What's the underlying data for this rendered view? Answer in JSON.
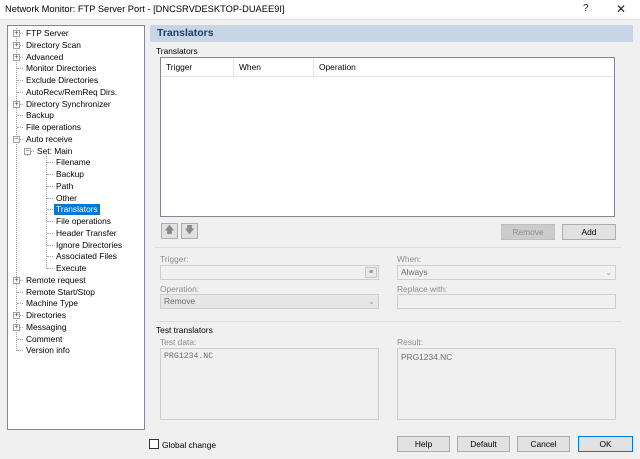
{
  "window": {
    "title": "Network Monitor: FTP Server Port - [DNCSRVDESKTOP-DUAEE9I]",
    "help_glyph": "?",
    "close_glyph": "✕"
  },
  "tree": {
    "items": [
      {
        "label": "FTP Server",
        "level": 0,
        "expander": "+"
      },
      {
        "label": "Directory Scan",
        "level": 0,
        "expander": "+"
      },
      {
        "label": "Advanced",
        "level": 0,
        "expander": "+"
      },
      {
        "label": "Monitor Directories",
        "level": 0,
        "expander": ""
      },
      {
        "label": "Exclude Directories",
        "level": 0,
        "expander": ""
      },
      {
        "label": "AutoRecv/RemReq Dirs.",
        "level": 0,
        "expander": ""
      },
      {
        "label": "Directory Synchronizer",
        "level": 0,
        "expander": "+"
      },
      {
        "label": "Backup",
        "level": 0,
        "expander": ""
      },
      {
        "label": "File operations",
        "level": 0,
        "expander": ""
      },
      {
        "label": "Auto receive",
        "level": 0,
        "expander": "−"
      },
      {
        "label": "Set: Main",
        "level": 1,
        "expander": "−"
      },
      {
        "label": "Filename",
        "level": 2,
        "expander": ""
      },
      {
        "label": "Backup",
        "level": 2,
        "expander": ""
      },
      {
        "label": "Path",
        "level": 2,
        "expander": ""
      },
      {
        "label": "Other",
        "level": 2,
        "expander": ""
      },
      {
        "label": "Translators",
        "level": 2,
        "expander": "",
        "selected": true
      },
      {
        "label": "File operations",
        "level": 2,
        "expander": ""
      },
      {
        "label": "Header Transfer",
        "level": 2,
        "expander": ""
      },
      {
        "label": "Ignore Directories",
        "level": 2,
        "expander": ""
      },
      {
        "label": "Associated Files",
        "level": 2,
        "expander": ""
      },
      {
        "label": "Execute",
        "level": 2,
        "expander": ""
      },
      {
        "label": "Remote request",
        "level": 0,
        "expander": "+"
      },
      {
        "label": "Remote Start/Stop",
        "level": 0,
        "expander": ""
      },
      {
        "label": "Machine Type",
        "level": 0,
        "expander": ""
      },
      {
        "label": "Directories",
        "level": 0,
        "expander": "+"
      },
      {
        "label": "Messaging",
        "level": 0,
        "expander": "+"
      },
      {
        "label": "Comment",
        "level": 0,
        "expander": ""
      },
      {
        "label": "Version info",
        "level": 0,
        "expander": ""
      }
    ]
  },
  "page": {
    "header": "Translators",
    "group_translators": "Translators",
    "table": {
      "columns": [
        "Trigger",
        "When",
        "Operation"
      ]
    },
    "buttons": {
      "move_up_glyph": "🡅",
      "move_down_glyph": "🡇",
      "remove": "Remove",
      "add": "Add"
    },
    "trigger": {
      "label": "Trigger:",
      "value": ""
    },
    "when": {
      "label": "When:",
      "value": "Always"
    },
    "operation": {
      "label": "Operation:",
      "value": "Remove"
    },
    "replace_with": {
      "label": "Replace with:",
      "value": ""
    },
    "test_group": "Test translators",
    "test_data": {
      "label": "Test data:",
      "value": "PRG1234.NC"
    },
    "result": {
      "label": "Result:",
      "value": "PRG1234.NC"
    }
  },
  "footer": {
    "global_change": "Global change",
    "help": "Help",
    "default": "Default",
    "cancel": "Cancel",
    "ok": "OK"
  }
}
